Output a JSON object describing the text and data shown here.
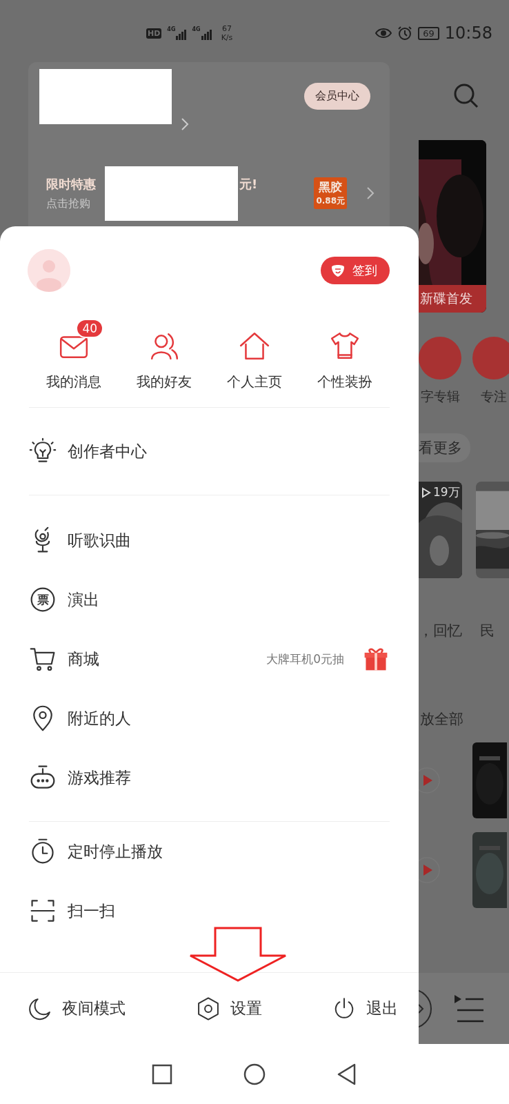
{
  "status_bar": {
    "hd": "HD",
    "sim1": "4G",
    "sim2": "4G",
    "speed": "67",
    "speed_unit": "K/s",
    "battery": "69",
    "time": "10:58"
  },
  "member_card": {
    "vip_button": "会员中心",
    "promo_title_start": "限时特惠",
    "promo_title_end": "元!",
    "promo_subtitle": "点击抢购",
    "vinyl_badge": {
      "title": "黑胶",
      "price": "0.88元"
    }
  },
  "profile": {
    "checkin_button": "签到"
  },
  "shortcuts": [
    {
      "label": "我的消息",
      "badge": "40",
      "kind": "mail"
    },
    {
      "label": "我的好友",
      "kind": "friends"
    },
    {
      "label": "个人主页",
      "kind": "home"
    },
    {
      "label": "个性装扮",
      "kind": "shirt"
    }
  ],
  "creator_item": {
    "label": "创作者中心",
    "kind": "bulb"
  },
  "menu_items": [
    {
      "label": "听歌识曲",
      "kind": "mic"
    },
    {
      "label": "演出",
      "kind": "ticket",
      "icon_text": "票"
    },
    {
      "label": "商城",
      "kind": "cart",
      "promo": "大牌耳机0元抽"
    },
    {
      "label": "附近的人",
      "kind": "pin"
    },
    {
      "label": "游戏推荐",
      "kind": "gamepad"
    }
  ],
  "tool_items": [
    {
      "label": "定时停止播放",
      "kind": "timer"
    },
    {
      "label": "扫一扫",
      "kind": "scan"
    }
  ],
  "footer_actions": [
    {
      "label": "夜间模式",
      "kind": "moon"
    },
    {
      "label": "设置",
      "kind": "settings"
    },
    {
      "label": "退出",
      "kind": "power"
    }
  ],
  "background_page": {
    "banner_label": "新碟首发",
    "categories": [
      "字专辑",
      "专注"
    ],
    "more_button": "看更多",
    "play_count": "19万",
    "playlist_titles": [
      "，回忆",
      "民"
    ],
    "play_all": "放全部"
  }
}
